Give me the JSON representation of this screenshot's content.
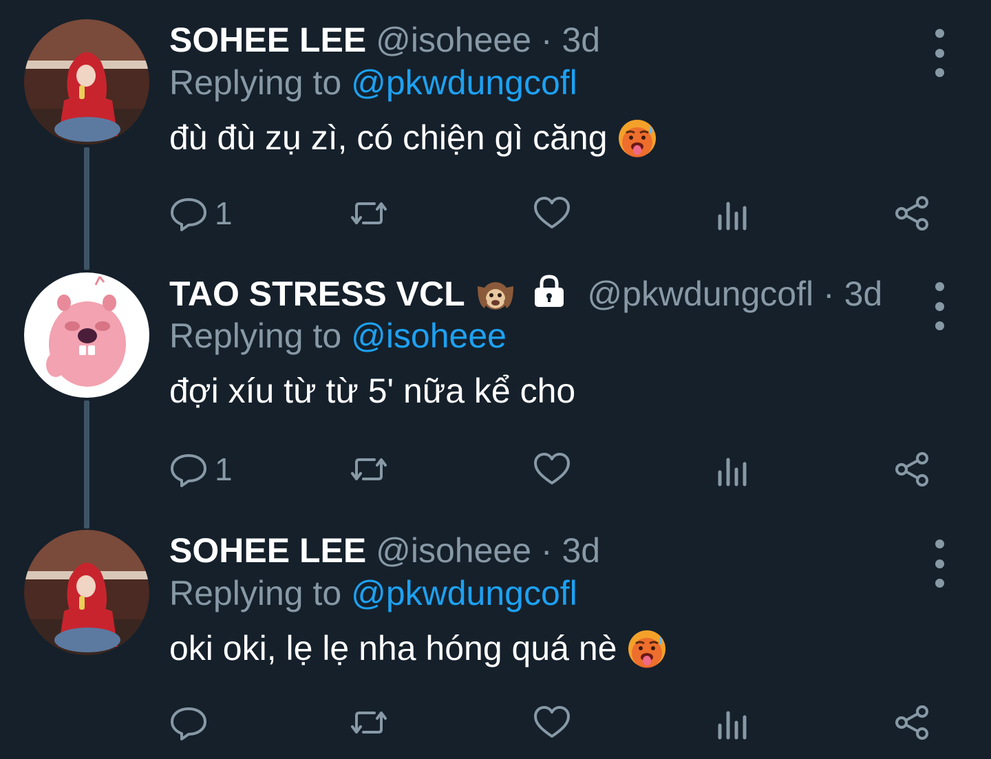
{
  "tweets": [
    {
      "author": {
        "display_name": "SOHEE LEE",
        "handle": "@isoheee",
        "avatar": "avatar-red-hoodie"
      },
      "separator": "·",
      "time": "3d",
      "replying_prefix": "Replying to",
      "replying_to": "@pkwdungcofl",
      "text": "đù đù zụ zì, có chiện gì căng",
      "text_emoji": "hot-face-emoji",
      "actions": {
        "reply_count": "1",
        "retweet_count": "",
        "like_count": ""
      }
    },
    {
      "author": {
        "display_name": "TAO STRESS VCL",
        "handle": "@pkwdungcofl",
        "avatar": "avatar-pink-beaver",
        "name_emoji": "hear-no-evil-monkey-emoji",
        "protected_icon": "lock-icon"
      },
      "separator": "·",
      "time": "3d",
      "replying_prefix": "Replying to",
      "replying_to": "@isoheee",
      "text": "đợi xíu từ từ 5' nữa kể cho",
      "actions": {
        "reply_count": "1",
        "retweet_count": "",
        "like_count": ""
      }
    },
    {
      "author": {
        "display_name": "SOHEE LEE",
        "handle": "@isoheee",
        "avatar": "avatar-red-hoodie"
      },
      "separator": "·",
      "time": "3d",
      "replying_prefix": "Replying to",
      "replying_to": "@pkwdungcofl",
      "text": "oki oki, lẹ lẹ nha hóng quá nè",
      "text_emoji": "hot-face-emoji",
      "actions": {
        "reply_count": "",
        "retweet_count": "",
        "like_count": ""
      }
    }
  ],
  "icons": {
    "reply": "reply-icon",
    "retweet": "retweet-icon",
    "like": "heart-icon",
    "analytics": "analytics-icon",
    "share": "share-icon",
    "more": "more-options-icon"
  },
  "colors": {
    "background": "#15202b",
    "secondary_text": "#8899a6",
    "link": "#1da1f2",
    "thread_line": "#3d5466"
  }
}
